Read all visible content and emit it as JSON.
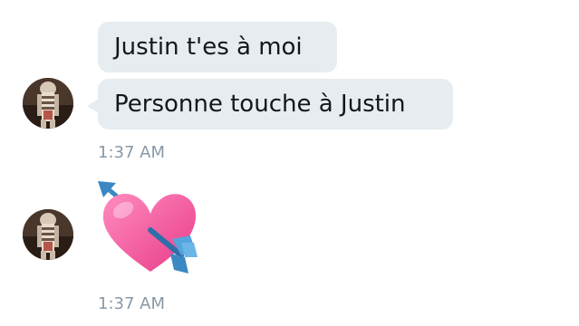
{
  "conversation": {
    "messages": [
      {
        "text": "Justin t'es à moi"
      },
      {
        "text": "Personne touche à Justin"
      }
    ],
    "group1_time": "1:37 AM",
    "emoji_message": {
      "emoji": "heart-with-arrow-icon"
    },
    "group2_time": "1:37 AM"
  },
  "colors": {
    "bubble_bg": "#e6ecf0",
    "text": "#14171a",
    "timestamp": "#8899a6",
    "heart": "#f75b9c",
    "arrow": "#3b88c3"
  }
}
